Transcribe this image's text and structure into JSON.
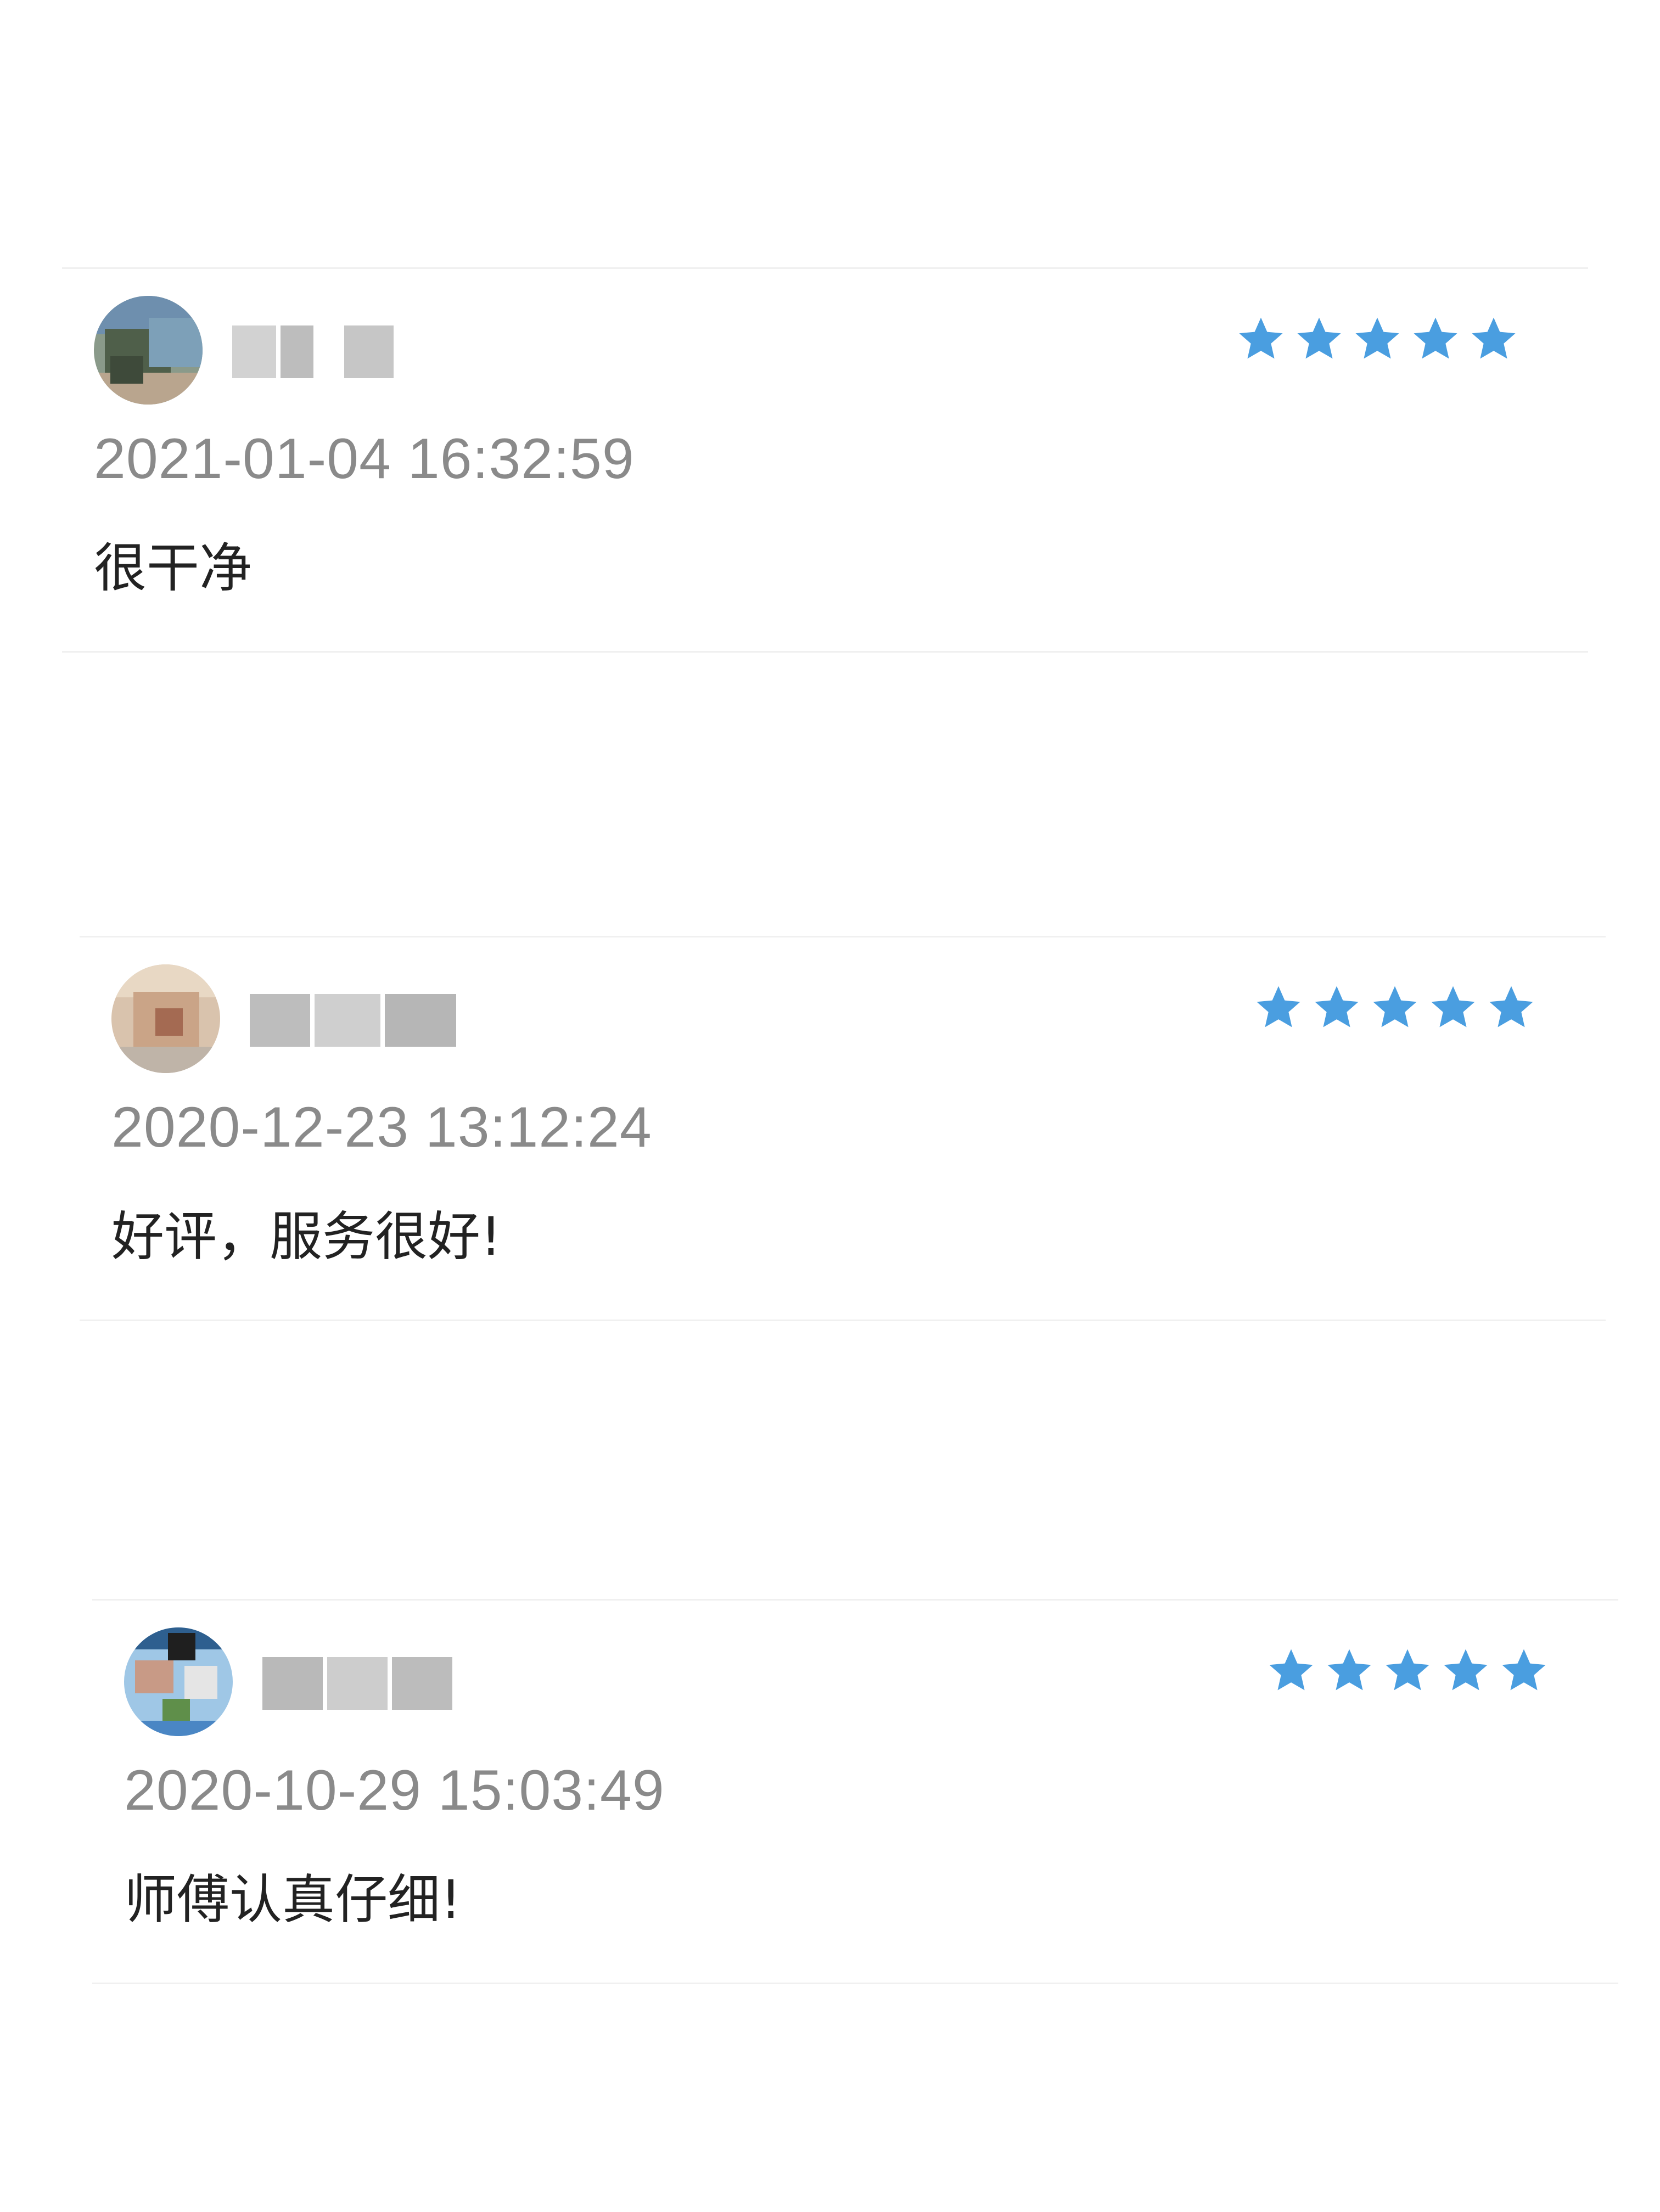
{
  "colors": {
    "star": "#4a9ee0",
    "timestamp": "#8a8a8a",
    "comment": "#222222",
    "divider": "#f0f0f0",
    "background": "#ffffff"
  },
  "reviews": [
    {
      "username": "",
      "username_blurred": true,
      "avatar_blurred": true,
      "rating": 5,
      "rating_max": 5,
      "timestamp": "2021-01-04 16:32:59",
      "comment": "很干净"
    },
    {
      "username": "",
      "username_blurred": true,
      "avatar_blurred": true,
      "rating": 5,
      "rating_max": 5,
      "timestamp": "2020-12-23 13:12:24",
      "comment": "好评，服务很好!"
    },
    {
      "username": "",
      "username_blurred": true,
      "avatar_blurred": true,
      "rating": 5,
      "rating_max": 5,
      "timestamp": "2020-10-29 15:03:49",
      "comment": "师傅认真仔细!"
    }
  ]
}
